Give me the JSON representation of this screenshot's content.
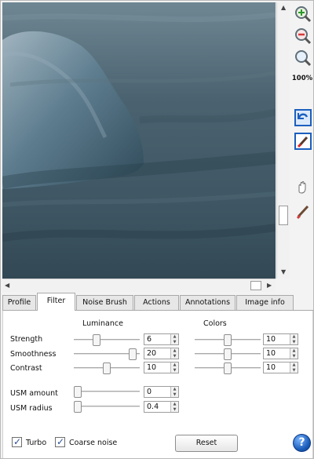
{
  "toolbar": {
    "zoom_level": "100%",
    "icons": [
      "zoom-in-icon",
      "zoom-out-icon",
      "zoom-fit-icon",
      "undo-icon",
      "brush-tool-icon",
      "hand-icon",
      "pen-icon"
    ]
  },
  "scroll": {
    "vertical_position": 0.77,
    "horizontal_position": 0.95
  },
  "tabs": [
    {
      "label": "Profile"
    },
    {
      "label": "Filter"
    },
    {
      "label": "Noise Brush"
    },
    {
      "label": "Actions"
    },
    {
      "label": "Annotations"
    },
    {
      "label": "Image info"
    }
  ],
  "active_tab": "Filter",
  "filter": {
    "luminance_label": "Luminance",
    "colors_label": "Colors",
    "rows": [
      {
        "label": "Strength",
        "luminance_value": "6",
        "luminance_slider": 0.33,
        "colors_value": "10",
        "colors_slider": 0.5
      },
      {
        "label": "Smoothness",
        "luminance_value": "20",
        "luminance_slider": 0.95,
        "colors_value": "10",
        "colors_slider": 0.5
      },
      {
        "label": "Contrast",
        "luminance_value": "10",
        "luminance_slider": 0.5,
        "colors_value": "10",
        "colors_slider": 0.5
      }
    ],
    "usm_amount_label": "USM amount",
    "usm_amount_value": "0",
    "usm_amount_slider": 0.0,
    "usm_radius_label": "USM radius",
    "usm_radius_value": "0.4",
    "usm_radius_slider": 0.0,
    "turbo_label": "Turbo",
    "turbo_checked": true,
    "coarse_noise_label": "Coarse noise",
    "coarse_noise_checked": true,
    "reset_label": "Reset",
    "help_label": "?"
  }
}
